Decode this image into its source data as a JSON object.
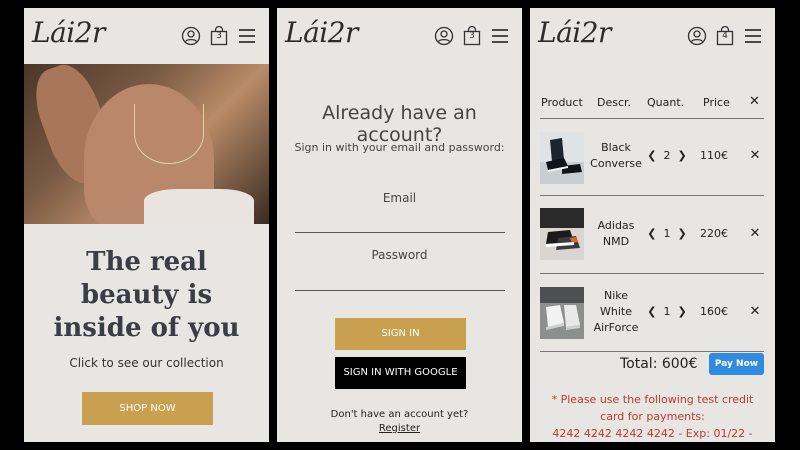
{
  "brand": {
    "logo": "Lái2r"
  },
  "screens": {
    "home": {
      "cart_count": "3",
      "tagline_lines": [
        "The real",
        "beauty is",
        "inside of you"
      ],
      "collection_link": "Click to see our collection",
      "shop_button": "SHOP NOW"
    },
    "login": {
      "cart_count": "3",
      "title": "Already have an account?",
      "subtitle": "Sign in with your email and password:",
      "email_label": "Email",
      "password_label": "Password",
      "sign_in_button": "SIGN IN",
      "google_button": "SIGN IN WITH GOOGLE",
      "no_account_text": "Don't have an account yet?",
      "register_link": "Register"
    },
    "cart": {
      "cart_count": "4",
      "headers": {
        "product": "Product",
        "description": "Descr.",
        "quantity": "Quant.",
        "price": "Price",
        "remove_all": "✕"
      },
      "items": [
        {
          "name_lines": [
            "Black",
            "Converse"
          ],
          "qty": "2",
          "price": "110€"
        },
        {
          "name_lines": [
            "Adidas",
            "NMD"
          ],
          "qty": "1",
          "price": "220€"
        },
        {
          "name_lines": [
            "Nike",
            "White",
            "AirForce"
          ],
          "qty": "1",
          "price": "160€"
        }
      ],
      "total": "Total: 600€",
      "pay_button": "Pay Now",
      "note_lines": [
        "* Please use the following test credit",
        "card for payments:",
        "4242 4242 4242 4242 - Exp: 01/22 -"
      ]
    }
  },
  "colors": {
    "background": "#e8e6e3",
    "accent_gold": "#c9a04f",
    "pay_blue": "#2e8be0",
    "note_red": "#c0392b"
  }
}
